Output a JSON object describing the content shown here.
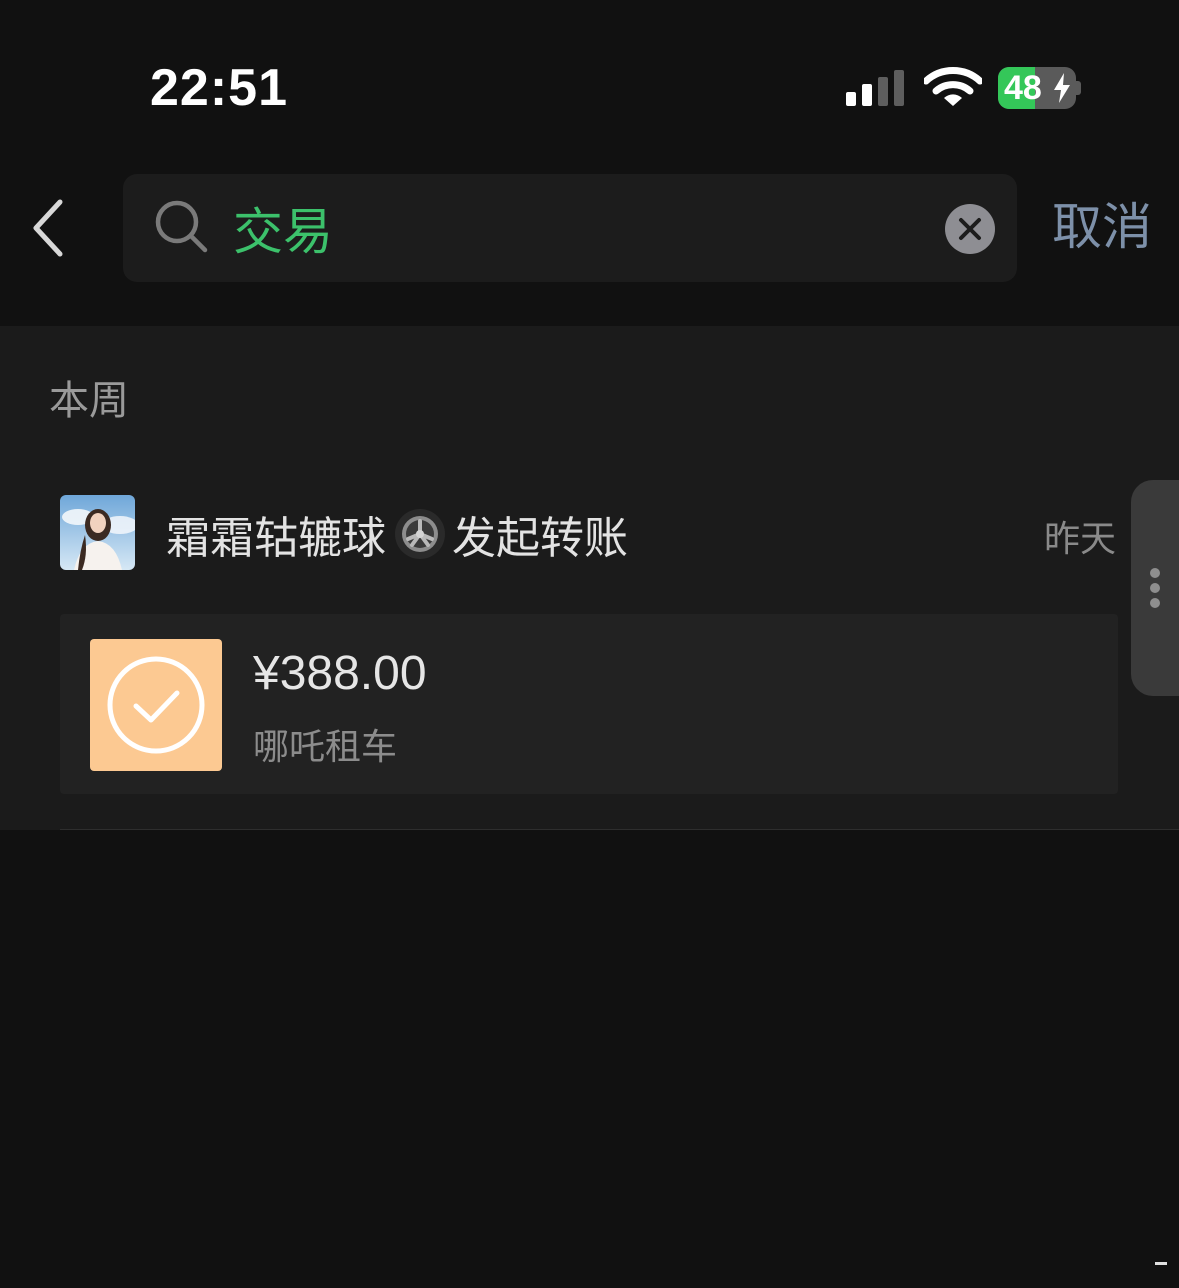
{
  "status_bar": {
    "time": "22:51",
    "battery_level": "48",
    "battery_fraction": 0.48,
    "charging": true,
    "signal_bars": 4,
    "signal_active_bars": 2
  },
  "search": {
    "back_icon": "chevron-left-icon",
    "search_icon": "magnifier-icon",
    "query": "交易",
    "query_color": "#3cc16b",
    "clear_icon": "clear-x-icon",
    "cancel_label": "取消"
  },
  "results": {
    "section_title": "本周",
    "item": {
      "name": "霜霜轱辘球",
      "name_emoji": "wheel-icon",
      "action": "发起转账",
      "date": "昨天",
      "transfer": {
        "amount": "¥388.00",
        "note": "哪吒租车",
        "icon": "check-circle-icon",
        "icon_bg": "#fcc992"
      }
    }
  },
  "colors": {
    "background": "#111111",
    "panel": "#1b1b1b",
    "accent_green": "#3cc16b",
    "cancel_blue": "#7d90a9"
  }
}
